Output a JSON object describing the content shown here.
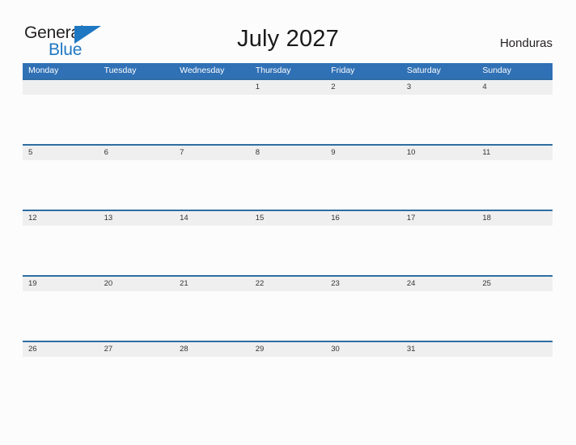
{
  "brand": {
    "name_part1": "General",
    "name_part2": "Blue",
    "flag_icon": "blue-triangle-flag-icon",
    "accent_color": "#1f77c2"
  },
  "header": {
    "title": "July 2027",
    "region": "Honduras"
  },
  "colors": {
    "header_blue": "#3071b5",
    "row_border_blue": "#2e6da4",
    "band_gray": "#efefef",
    "page_background": "#fcfcfd",
    "brand_blue": "#1f77c2",
    "text_dark": "#231f20"
  },
  "calendar": {
    "month": "July",
    "year": "2027",
    "week_start": "Monday",
    "day_headers": [
      "Monday",
      "Tuesday",
      "Wednesday",
      "Thursday",
      "Friday",
      "Saturday",
      "Sunday"
    ],
    "weeks": [
      [
        "",
        "",
        "",
        "1",
        "2",
        "3",
        "4"
      ],
      [
        "5",
        "6",
        "7",
        "8",
        "9",
        "10",
        "11"
      ],
      [
        "12",
        "13",
        "14",
        "15",
        "16",
        "17",
        "18"
      ],
      [
        "19",
        "20",
        "21",
        "22",
        "23",
        "24",
        "25"
      ],
      [
        "26",
        "27",
        "28",
        "29",
        "30",
        "31",
        ""
      ]
    ]
  }
}
